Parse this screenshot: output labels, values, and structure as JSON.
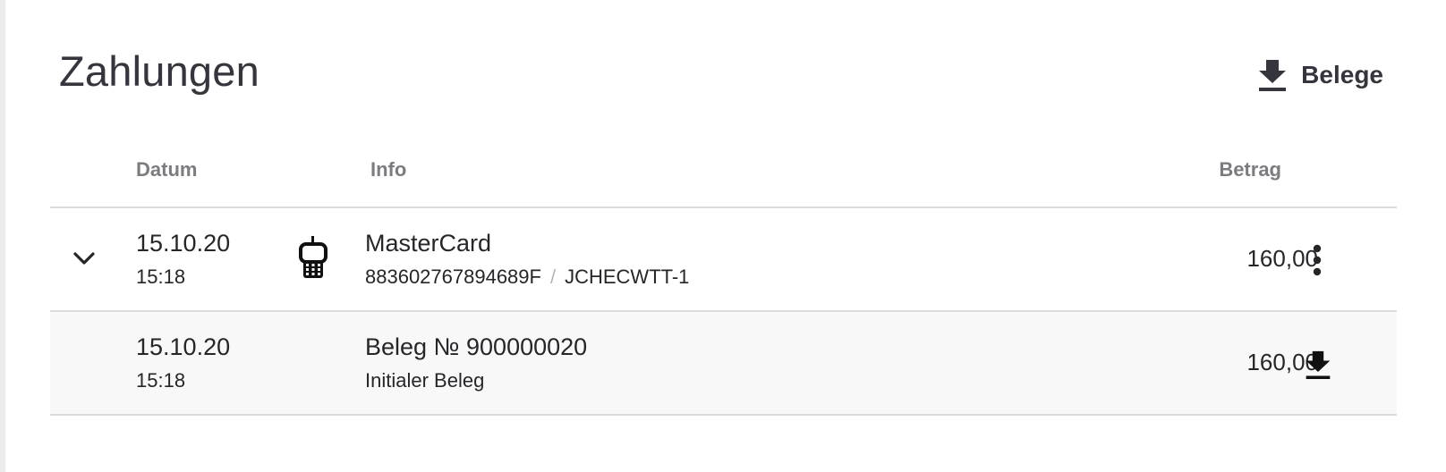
{
  "header": {
    "title": "Zahlungen",
    "receipts_button": {
      "label": "Belege",
      "icon": "download-icon"
    }
  },
  "table": {
    "columns": {
      "date": "Datum",
      "info": "Info",
      "amount": "Betrag"
    },
    "payment": {
      "date": "15.10.20",
      "time": "15:18",
      "device_icon": "terminal-icon",
      "method": "MasterCard",
      "reference": "883602767894689F",
      "separator": "/",
      "terminal_id": "JCHECWTT-1",
      "amount": "160,00",
      "expand_icon": "chevron-down-icon",
      "menu_icon": "more-vertical-icon"
    },
    "receipt": {
      "date": "15.10.20",
      "time": "15:18",
      "title": "Beleg № 900000020",
      "subtitle": "Initialer Beleg",
      "amount": "160,00",
      "download_icon": "download-icon"
    }
  },
  "colors": {
    "text": "#26262a",
    "header_text": "#7c7c80",
    "divider": "#dcdcdc",
    "sub_row_bg": "#f8f8f8"
  }
}
